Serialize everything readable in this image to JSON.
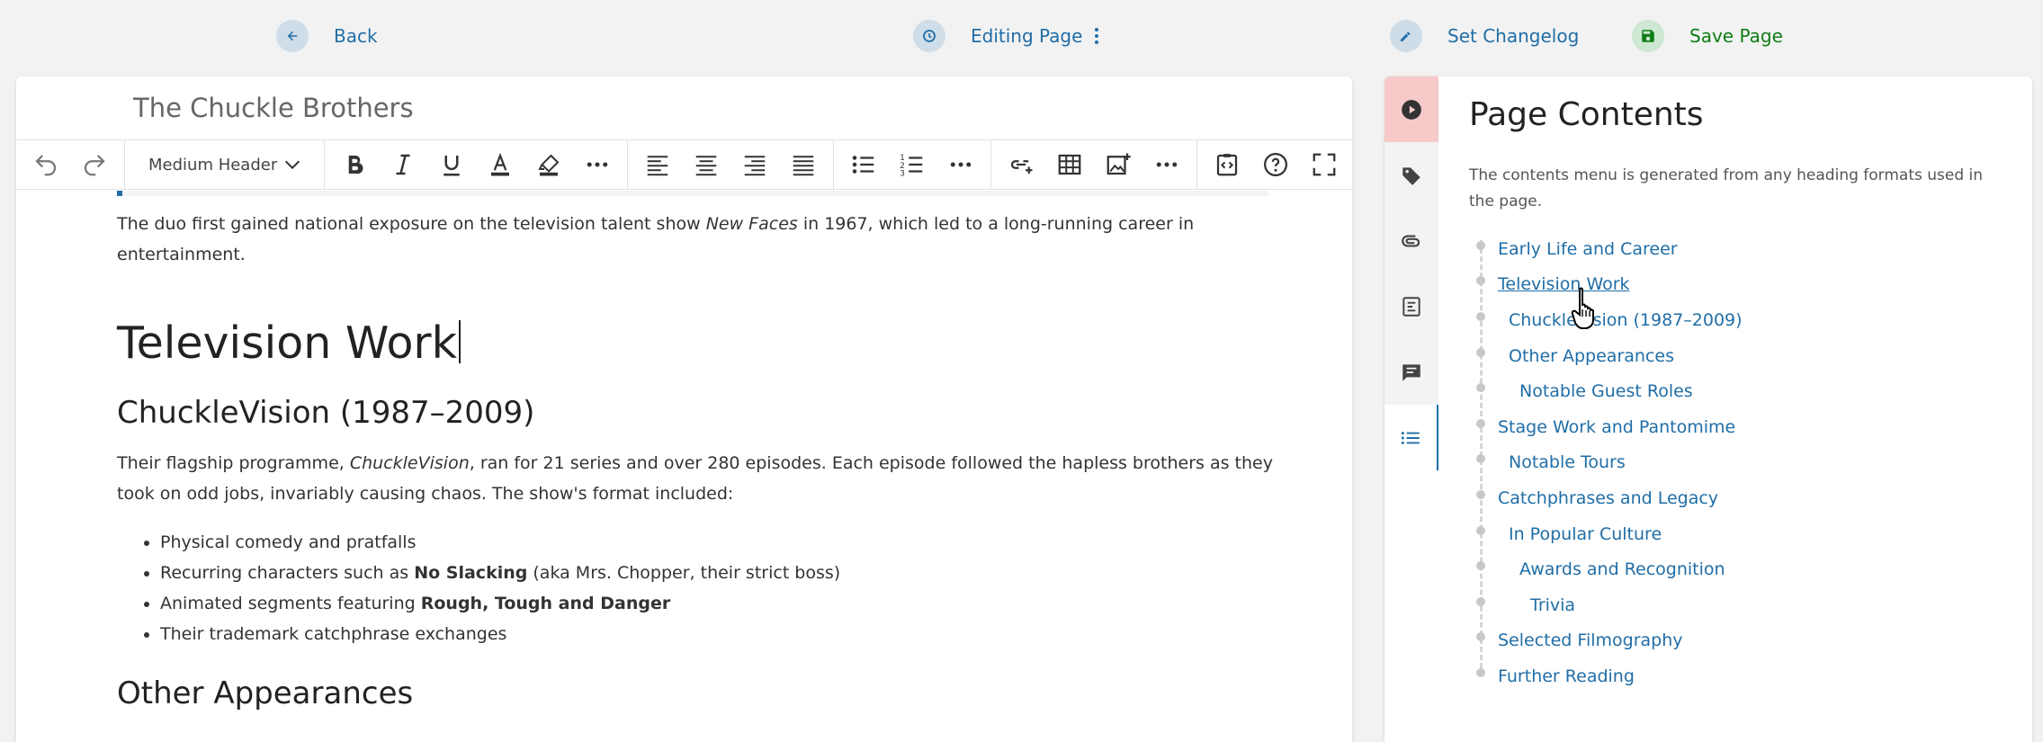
{
  "topbar": {
    "back_label": "Back",
    "editing_label": "Editing Page",
    "changelog_label": "Set Changelog",
    "save_label": "Save Page",
    "accent": "#206ea7",
    "save_color": "#0f7d15"
  },
  "editor": {
    "page_title": "The Chuckle Brothers",
    "format_select_value": "Medium Header",
    "toolbar_icons": [
      "undo-icon",
      "redo-icon",
      "bold-icon",
      "italic-icon",
      "underline-icon",
      "text-color-icon",
      "highlight-icon",
      "more-icon",
      "align-left-icon",
      "align-center-icon",
      "align-right-icon",
      "align-justify-icon",
      "bullet-list-icon",
      "numbered-list-icon",
      "more-icon",
      "insert-link-icon",
      "table-icon",
      "insert-image-icon",
      "more-icon",
      "source-code-icon",
      "help-icon",
      "fullscreen-icon"
    ]
  },
  "content": {
    "intro_p1": "The duo first gained national exposure on the television talent show ",
    "intro_em": "New Faces",
    "intro_p2": " in 1967, which led to a long-running career in entertainment.",
    "h_television": "Television Work",
    "h_chucklevision": "ChuckleVision (1987–2009)",
    "cv_p1": "Their flagship programme, ",
    "cv_em": "ChuckleVision",
    "cv_p2": ", ran for 21 series and over 280 episodes. Each episode followed the hapless brothers as they took on odd jobs, invariably causing chaos. The show's format included:",
    "bullets": {
      "b1": "Physical comedy and pratfalls",
      "b2_pre": "Recurring characters such as ",
      "b2_bold": "No Slacking",
      "b2_post": " (aka Mrs. Chopper, their strict boss)",
      "b3_pre": "Animated segments featuring ",
      "b3_bold": "Rough, Tough and Danger",
      "b4": "Their trademark catchphrase exchanges"
    },
    "h_other": "Other Appearances"
  },
  "sidebar": {
    "title": "Page Contents",
    "description": "The contents menu is generated from any heading formats used in the page.",
    "tabs": [
      "play-icon",
      "tag-icon",
      "attachment-icon",
      "template-icon",
      "comment-icon",
      "list-icon"
    ],
    "items": [
      {
        "label": "Early Life and Career",
        "level": 1
      },
      {
        "label": "Television Work",
        "level": 1
      },
      {
        "label": "ChuckleVision (1987–2009)",
        "level": 2
      },
      {
        "label": "Other Appearances",
        "level": 2
      },
      {
        "label": "Notable Guest Roles",
        "level": 3
      },
      {
        "label": "Stage Work and Pantomime",
        "level": 1
      },
      {
        "label": "Notable Tours",
        "level": 2
      },
      {
        "label": "Catchphrases and Legacy",
        "level": 1
      },
      {
        "label": "In Popular Culture",
        "level": 2
      },
      {
        "label": "Awards and Recognition",
        "level": 3
      },
      {
        "label": "Trivia",
        "level": 4
      },
      {
        "label": "Selected Filmography",
        "level": 1
      },
      {
        "label": "Further Reading",
        "level": 1
      }
    ]
  }
}
